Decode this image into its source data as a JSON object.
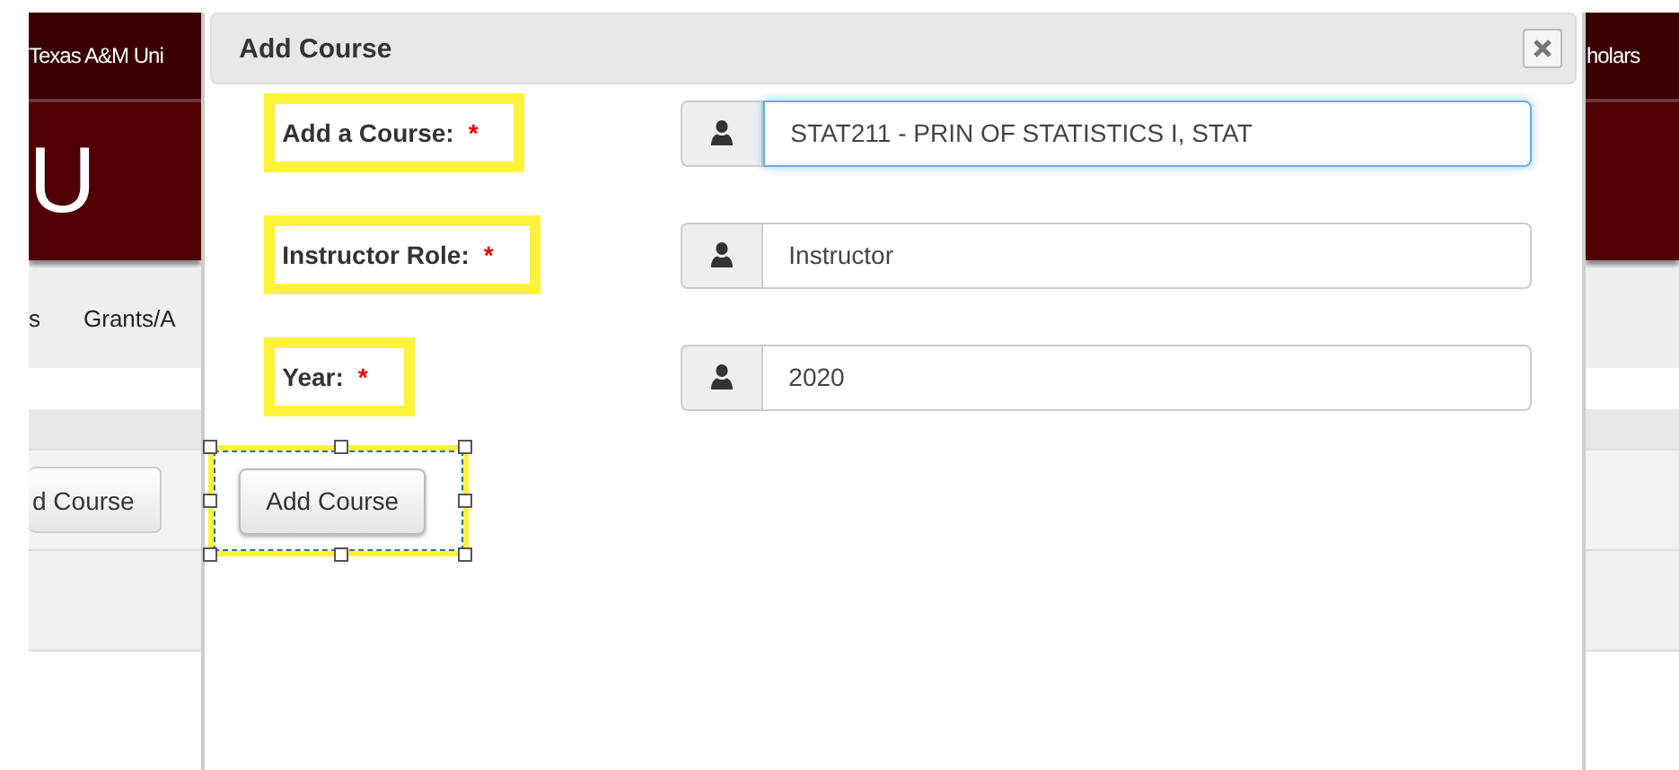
{
  "background": {
    "header_text": "Texas A&M Uni",
    "logo_text": "U",
    "nav_items": [
      "s",
      "Grants/A"
    ],
    "button": "d Course",
    "right_header_text": "holars"
  },
  "dialog": {
    "title": "Add Course",
    "fields": [
      {
        "label": "Add a Course:",
        "required_mark": "*",
        "value": "STAT211 - PRIN OF STATISTICS I, STAT",
        "focused": true,
        "highlighted": true
      },
      {
        "label": "Instructor Role:",
        "required_mark": "*",
        "value": "Instructor",
        "focused": false,
        "highlighted": true
      },
      {
        "label": "Year:",
        "required_mark": "*",
        "value": "2020",
        "focused": false,
        "highlighted": true
      }
    ],
    "submit": {
      "label": "Add Course",
      "selected": true
    }
  }
}
